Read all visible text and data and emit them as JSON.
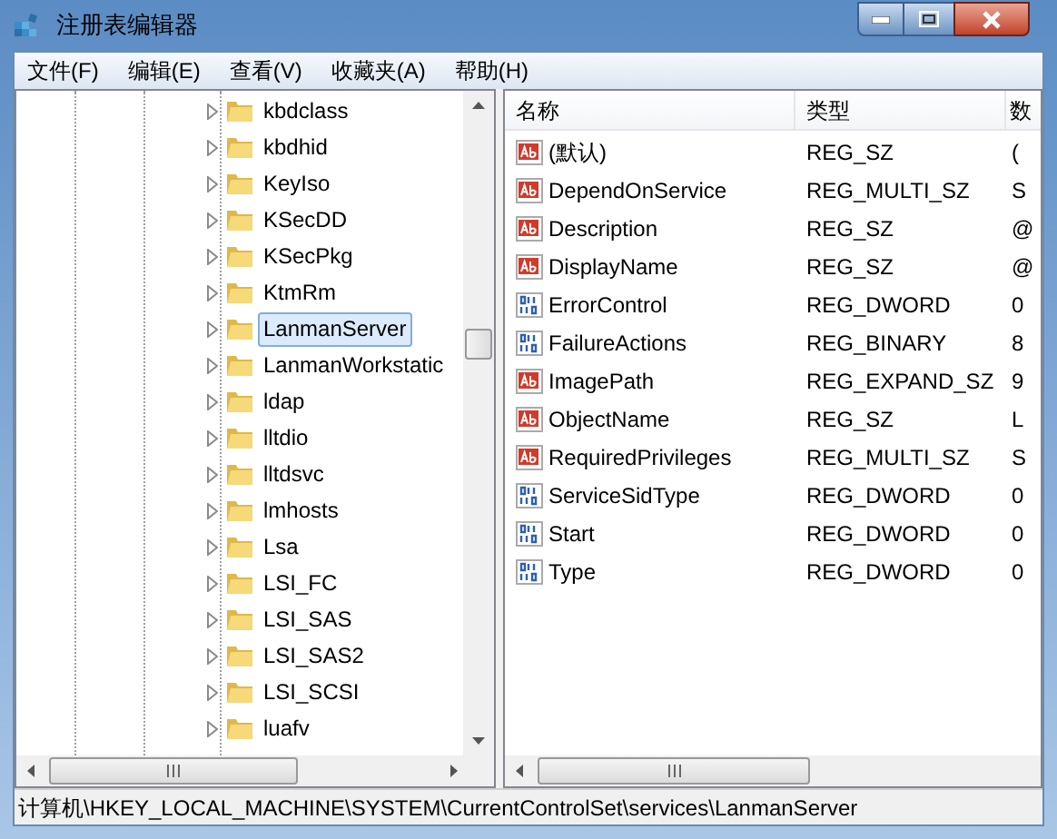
{
  "window": {
    "title": "注册表编辑器"
  },
  "menu": [
    "文件(F)",
    "编辑(E)",
    "查看(V)",
    "收藏夹(A)",
    "帮助(H)"
  ],
  "tree": {
    "items": [
      {
        "label": "kbdclass",
        "selected": false
      },
      {
        "label": "kbdhid",
        "selected": false
      },
      {
        "label": "KeyIso",
        "selected": false
      },
      {
        "label": "KSecDD",
        "selected": false
      },
      {
        "label": "KSecPkg",
        "selected": false
      },
      {
        "label": "KtmRm",
        "selected": false
      },
      {
        "label": "LanmanServer",
        "selected": true
      },
      {
        "label": "LanmanWorkstatic",
        "selected": false
      },
      {
        "label": "ldap",
        "selected": false
      },
      {
        "label": "lltdio",
        "selected": false
      },
      {
        "label": "lltdsvc",
        "selected": false
      },
      {
        "label": "lmhosts",
        "selected": false
      },
      {
        "label": "Lsa",
        "selected": false
      },
      {
        "label": "LSI_FC",
        "selected": false
      },
      {
        "label": "LSI_SAS",
        "selected": false
      },
      {
        "label": "LSI_SAS2",
        "selected": false
      },
      {
        "label": "LSI_SCSI",
        "selected": false
      },
      {
        "label": "luafv",
        "selected": false
      }
    ]
  },
  "values": {
    "columns": [
      "名称",
      "类型",
      "数"
    ],
    "rows": [
      {
        "kind": "string",
        "name": "(默认)",
        "type": "REG_SZ",
        "column_3": "("
      },
      {
        "kind": "string",
        "name": "DependOnService",
        "type": "REG_MULTI_SZ",
        "column_3": "S"
      },
      {
        "kind": "string",
        "name": "Description",
        "type": "REG_SZ",
        "column_3": "@"
      },
      {
        "kind": "string",
        "name": "DisplayName",
        "type": "REG_SZ",
        "column_3": "@"
      },
      {
        "kind": "binary",
        "name": "ErrorControl",
        "type": "REG_DWORD",
        "column_3": "0"
      },
      {
        "kind": "binary",
        "name": "FailureActions",
        "type": "REG_BINARY",
        "column_3": "8"
      },
      {
        "kind": "string",
        "name": "ImagePath",
        "type": "REG_EXPAND_SZ",
        "column_3": "9"
      },
      {
        "kind": "string",
        "name": "ObjectName",
        "type": "REG_SZ",
        "column_3": "L"
      },
      {
        "kind": "string",
        "name": "RequiredPrivileges",
        "type": "REG_MULTI_SZ",
        "column_3": "S"
      },
      {
        "kind": "binary",
        "name": "ServiceSidType",
        "type": "REG_DWORD",
        "column_3": "0"
      },
      {
        "kind": "binary",
        "name": "Start",
        "type": "REG_DWORD",
        "column_3": "0"
      },
      {
        "kind": "binary",
        "name": "Type",
        "type": "REG_DWORD",
        "column_3": "0"
      }
    ]
  },
  "status_bar": "计算机\\HKEY_LOCAL_MACHINE\\SYSTEM\\CurrentControlSet\\services\\LanmanServer"
}
